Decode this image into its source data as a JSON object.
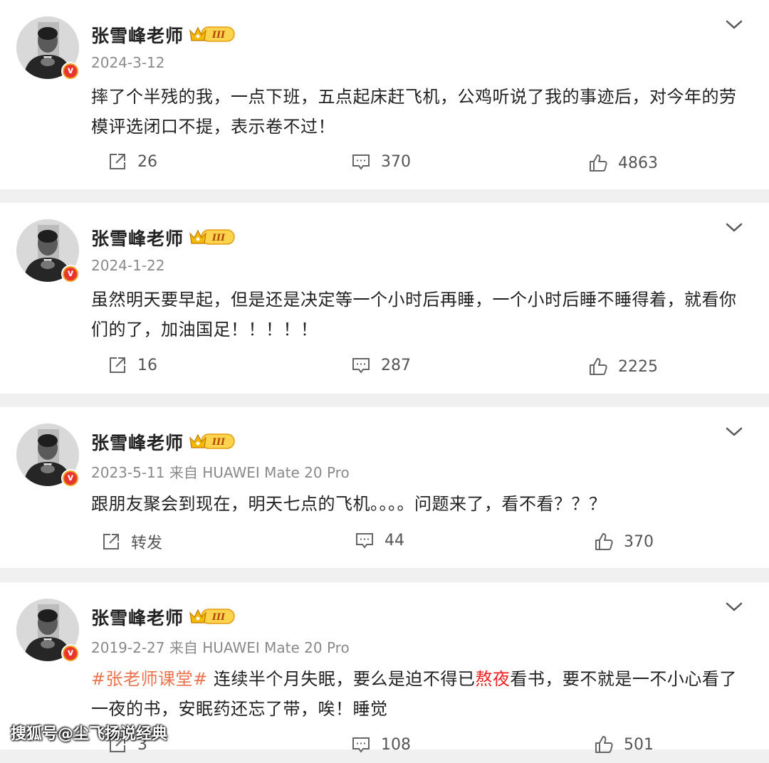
{
  "posts": [
    {
      "author": "张雪峰老师",
      "meta": "2024-3-12",
      "content_parts": [
        {
          "type": "text",
          "text": "摔了个半残的我，一点下班，五点起床赶飞机，公鸡听说了我的事迹后，对今年的劳模评选闭口不提，表示卷不过！"
        }
      ],
      "repost": "26",
      "comments": "370",
      "likes": "4863"
    },
    {
      "author": "张雪峰老师",
      "meta": "2024-1-22",
      "content_parts": [
        {
          "type": "text",
          "text": "虽然明天要早起，但是还是决定等一个小时后再睡，一个小时后睡不睡得着，就看你们的了，加油国足！！！！！"
        }
      ],
      "repost": "16",
      "comments": "287",
      "likes": "2225"
    },
    {
      "author": "张雪峰老师",
      "meta": "2023-5-11 来自 HUAWEI Mate 20 Pro",
      "content_parts": [
        {
          "type": "text",
          "text": "跟朋友聚会到现在，明天七点的飞机。。。。问题来了，看不看？？？"
        }
      ],
      "repost": "转发",
      "comments": "44",
      "likes": "370"
    },
    {
      "author": "张雪峰老师",
      "meta": "2019-2-27 来自 HUAWEI Mate 20 Pro",
      "content_parts": [
        {
          "type": "hashtag",
          "text": "#张老师课堂#"
        },
        {
          "type": "text",
          "text": " 连续半个月失眠，要么是迫不得已"
        },
        {
          "type": "highlight",
          "text": "熬夜"
        },
        {
          "type": "text",
          "text": "看书，要不就是一不小心看了一夜的书，安眠药还忘了带，唉！睡觉"
        }
      ],
      "repost": "3",
      "comments": "108",
      "likes": "501"
    }
  ],
  "badge": {
    "crown_label": "III",
    "verified_glyph": "v"
  },
  "watermark": "搜狐号@尘飞扬说经典",
  "colors": {
    "hashtag": "#eb7350",
    "highlight": "#ee2222",
    "crown": "#f5b800"
  }
}
